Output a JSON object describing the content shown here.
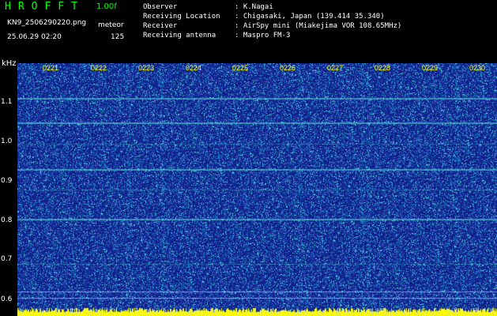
{
  "header": {
    "app_title": "HROFFT",
    "version": "1.00f",
    "filename": "KN9_2506290220.png",
    "mode": "meteor",
    "datetime": "25.06.29 02:20",
    "count": "125"
  },
  "meta": [
    {
      "label": "Observer",
      "value": ": K.Nagai"
    },
    {
      "label": "Receiving Location",
      "value": ": Chigasaki, Japan (139.414 35.340)"
    },
    {
      "label": "Receiver",
      "value": ": AirSpy mini (Miakejima VOR 108.65MHz)"
    },
    {
      "label": "Receiving antenna",
      "value": ": Maspro FM-3"
    }
  ],
  "y_axis": {
    "unit": "kHz",
    "ticks": [
      "1.1",
      "1.0",
      "0.9",
      "0.8",
      "0.7",
      "0.6"
    ]
  },
  "x_axis": {
    "ticks": [
      "0221",
      "0222",
      "0223",
      "0224",
      "0225",
      "0226",
      "0227",
      "0228",
      "0229",
      "0230"
    ]
  },
  "colors": {
    "background": "#1a33a8",
    "noise": "#3fb0d8",
    "line": "#60e0e0",
    "footer": "#ffff00"
  }
}
